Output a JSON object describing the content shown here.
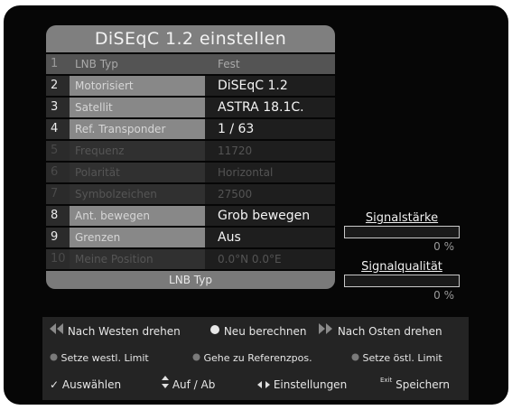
{
  "title": "DiSEqC 1.2 einstellen",
  "rows": [
    {
      "index": "1",
      "label": "LNB Typ",
      "value": "Fest"
    },
    {
      "index": "2",
      "label": "Motorisiert",
      "value": "DiSEqC 1.2"
    },
    {
      "index": "3",
      "label": "Satellit",
      "value": "ASTRA 18.1C."
    },
    {
      "index": "4",
      "label": "Ref. Transponder",
      "value": "1 / 63"
    },
    {
      "index": "5",
      "label": "Frequenz",
      "value": "11720"
    },
    {
      "index": "6",
      "label": "Polarität",
      "value": "Horizontal"
    },
    {
      "index": "7",
      "label": "Symbolzeichen",
      "value": "27500"
    },
    {
      "index": "8",
      "label": "Ant. bewegen",
      "value": "Grob bewegen"
    },
    {
      "index": "9",
      "label": "Grenzen",
      "value": "Aus"
    },
    {
      "index": "10",
      "label": "Meine Position",
      "value": "0.0°N 0.0°E"
    }
  ],
  "footer": "LNB Typ",
  "signal_strength": {
    "label": "Signalstärke",
    "value": "0 %",
    "level": 0
  },
  "signal_quality": {
    "label": "Signalqualität",
    "value": "0 %",
    "level": 0
  },
  "help": {
    "west": "Nach Westen drehen",
    "recalc": "Neu berechnen",
    "east": "Nach Osten drehen",
    "west_limit": "Setze westl. Limit",
    "goto_ref": "Gehe zu Referenzpos.",
    "east_limit": "Setze östl. Limit",
    "select": "Auswählen",
    "updown": "Auf / Ab",
    "settings": "Einstellungen",
    "exit_icon": "Exit",
    "save": "Speichern"
  },
  "icons": {
    "west": "double-left-arrow-icon",
    "recalc": "white-dot-icon",
    "east": "double-right-arrow-icon",
    "red": "red-button-icon",
    "green": "green-button-icon",
    "yellow": "yellow-button-icon",
    "ok": "checkmark-icon",
    "updown": "up-down-arrows-icon",
    "leftright": "left-right-arrows-icon"
  }
}
